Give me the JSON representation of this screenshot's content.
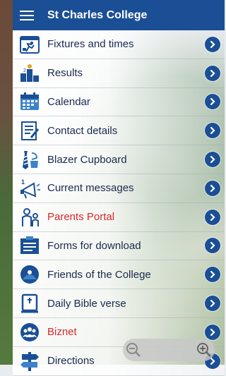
{
  "header": {
    "title": "St Charles College"
  },
  "menu": [
    {
      "label": "Fixtures and times",
      "icon": "fixtures-icon",
      "color": "#1a2a4f"
    },
    {
      "label": "Results",
      "icon": "results-podium-icon",
      "color": "#1a2a4f"
    },
    {
      "label": "Calendar",
      "icon": "calendar-icon",
      "color": "#1a2a4f"
    },
    {
      "label": "Contact details",
      "icon": "contact-form-icon",
      "color": "#1a2a4f"
    },
    {
      "label": "Blazer Cupboard",
      "icon": "blazer-tie-icon",
      "color": "#1a2a4f"
    },
    {
      "label": "Current messages",
      "icon": "megaphone-icon",
      "color": "#1a2a4f"
    },
    {
      "label": "Parents Portal",
      "icon": "parent-child-icon",
      "color": "#d6282b"
    },
    {
      "label": "Forms for download",
      "icon": "forms-icon",
      "color": "#1a2a4f"
    },
    {
      "label": "Friends of the College",
      "icon": "friends-globe-icon",
      "color": "#1a2a4f"
    },
    {
      "label": "Daily Bible verse",
      "icon": "bible-icon",
      "color": "#1a2a4f"
    },
    {
      "label": "Biznet",
      "icon": "biznet-people-icon",
      "color": "#d6282b"
    },
    {
      "label": "Directions",
      "icon": "signpost-icon",
      "color": "#1a2a4f"
    }
  ],
  "colors": {
    "header": "#1b4f95",
    "chevron": "#1b4f95"
  }
}
